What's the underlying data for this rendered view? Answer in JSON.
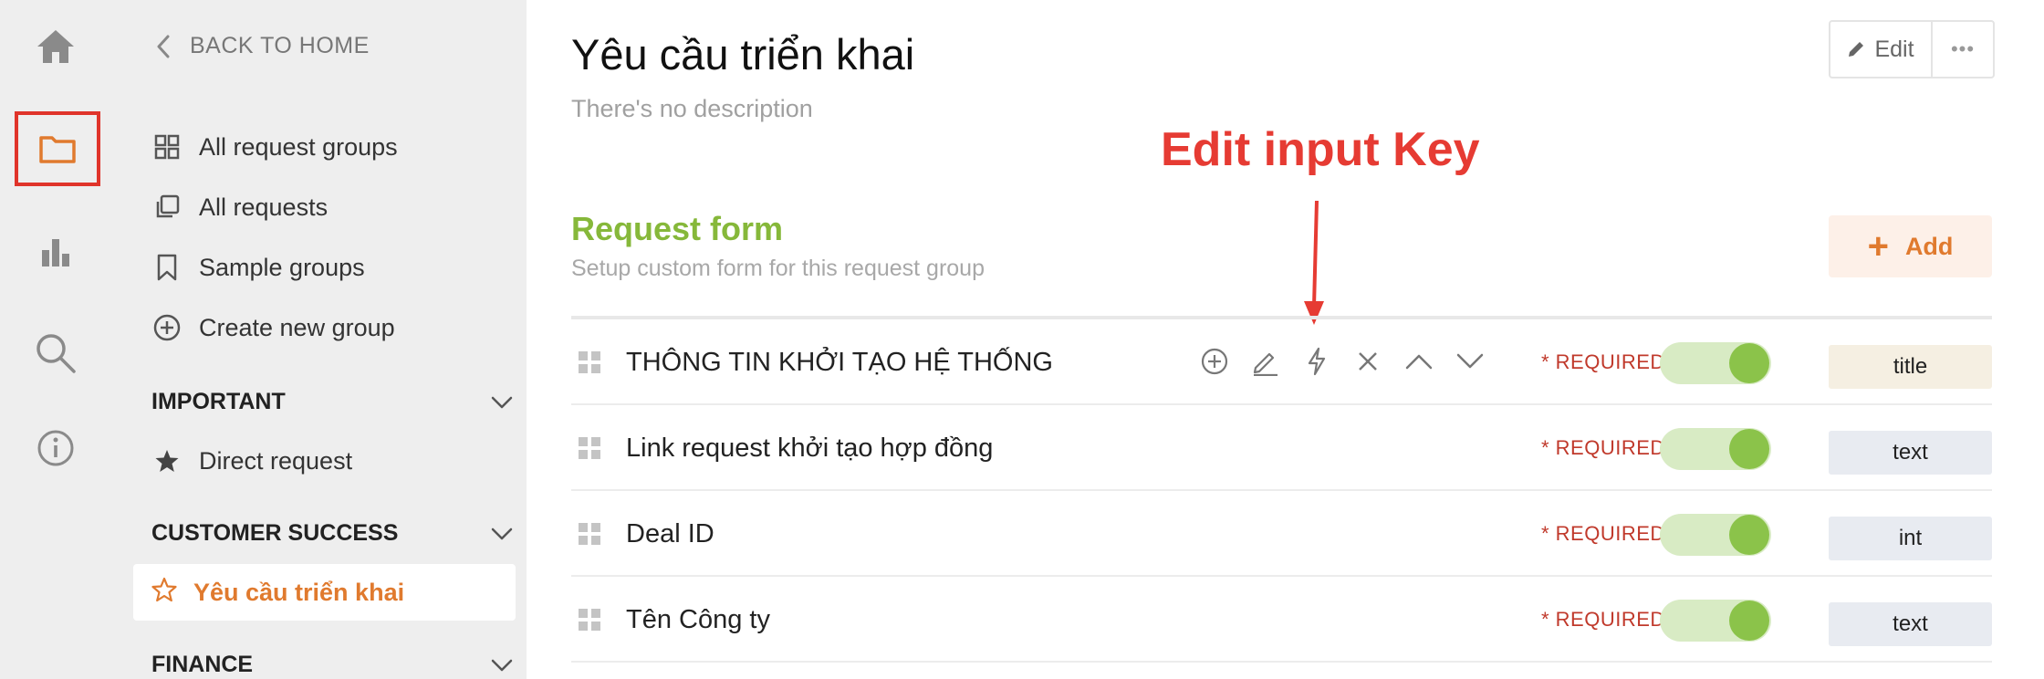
{
  "rail": {
    "icons": [
      "home-icon",
      "folder-icon",
      "bar-chart-icon",
      "search-icon",
      "info-icon"
    ]
  },
  "sidebar": {
    "back_label": "BACK TO HOME",
    "nav": [
      {
        "label": "All request groups",
        "icon": "grid-icon"
      },
      {
        "label": "All requests",
        "icon": "copy-icon"
      },
      {
        "label": "Sample groups",
        "icon": "bookmark-icon"
      },
      {
        "label": "Create new group",
        "icon": "plus-circle-icon"
      }
    ],
    "sections": [
      {
        "title": "IMPORTANT",
        "items": [
          {
            "label": "Direct request",
            "icon": "star-filled-icon"
          }
        ]
      },
      {
        "title": "CUSTOMER SUCCESS",
        "items": [
          {
            "label": "Yêu cầu triển khai",
            "icon": "star-outline-icon"
          }
        ]
      },
      {
        "title": "FINANCE",
        "items": []
      }
    ]
  },
  "main": {
    "title": "Yêu cầu triển khai",
    "description": "There's no description",
    "edit_label": "Edit",
    "more_label": "•••",
    "annotation": "Edit input Key",
    "form": {
      "title": "Request form",
      "subtitle": "Setup custom form for this request group",
      "add_label": "Add",
      "rows": [
        {
          "label": "THÔNG TIN KHỞI TẠO HỆ THỐNG",
          "required": "* REQUIRED",
          "enabled": true,
          "type": "title"
        },
        {
          "label": "Link request khởi tạo hợp đồng",
          "required": "* REQUIRED",
          "enabled": true,
          "type": "text"
        },
        {
          "label": "Deal ID",
          "required": "* REQUIRED",
          "enabled": true,
          "type": "int"
        },
        {
          "label": "Tên Công ty",
          "required": "* REQUIRED",
          "enabled": true,
          "type": "text"
        }
      ]
    }
  },
  "colors": {
    "accent_orange": "#e07a2e",
    "form_green": "#86b83a",
    "toggle_green": "#8bc34a",
    "required_red": "#c0392b",
    "annotation_red": "#e63b33"
  }
}
